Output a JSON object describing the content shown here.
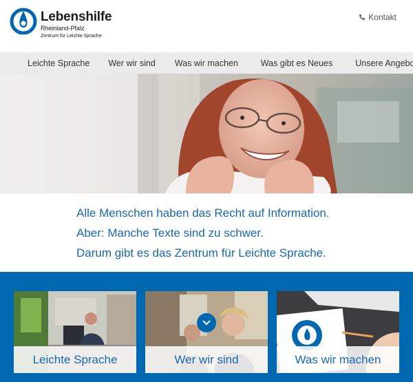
{
  "header": {
    "logo_title": "Lebenshilfe",
    "logo_subtitle": "Rheinland-Pfalz",
    "logo_tagline": "Zentrum für Leichte Sprache",
    "contact_label": "Kontakt",
    "contact_icon": "phone-icon"
  },
  "nav": {
    "items": [
      {
        "label": "Leichte Sprache"
      },
      {
        "label": "Wer wir sind"
      },
      {
        "label": "Was wir machen"
      },
      {
        "label": "Was gibt es Neues"
      },
      {
        "label": "Unsere Angebote"
      }
    ]
  },
  "intro": {
    "lines": [
      "Alle Menschen haben das Recht auf Information.",
      "Aber: Manche Texte sind zu schwer.",
      "Darum gibt es das Zentrum für Leichte Sprache."
    ]
  },
  "cards": [
    {
      "label": "Leichte Sprache"
    },
    {
      "label": "Wer wir sind",
      "icon": "chevron-down-icon"
    },
    {
      "label": "Was wir machen"
    }
  ],
  "colors": {
    "brand_blue": "#0067b1",
    "text_blue": "#1967b3",
    "nav_bg": "#ebebeb"
  }
}
